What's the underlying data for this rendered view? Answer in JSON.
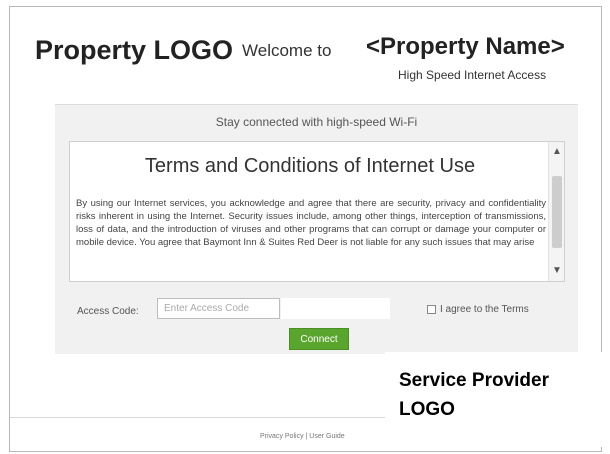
{
  "header": {
    "property_logo": "Property LOGO",
    "welcome": "Welcome to",
    "property_name": "<Property Name>",
    "subtitle": "High Speed Internet Access"
  },
  "panel": {
    "tagline": "Stay connected with high-speed Wi-Fi",
    "terms": {
      "title": "Terms and Conditions of Internet Use",
      "body": "By using our Internet services, you acknowledge and agree that there are security, privacy and confidentiality risks inherent in using the Internet. Security issues include, among other things, interception of transmissions, loss of data, and the introduction of viruses and other programs that can corrupt or damage your computer or mobile device. You agree that Baymont Inn & Suites Red Deer is not liable for any such issues that may arise"
    },
    "access_code": {
      "label": "Access Code:",
      "placeholder": "Enter Access Code",
      "value": ""
    },
    "agree_label": "I agree to the Terms",
    "connect_label": "Connect"
  },
  "service_provider": {
    "logo_text": "Service Provider LOGO"
  },
  "footer": {
    "links": "Privacy Policy | User Guide"
  },
  "icons": {
    "scroll_up": "chevron-up-icon",
    "scroll_down": "chevron-down-icon"
  },
  "colors": {
    "connect_button": "#5aa52e",
    "panel_background": "#f1f1f1"
  }
}
